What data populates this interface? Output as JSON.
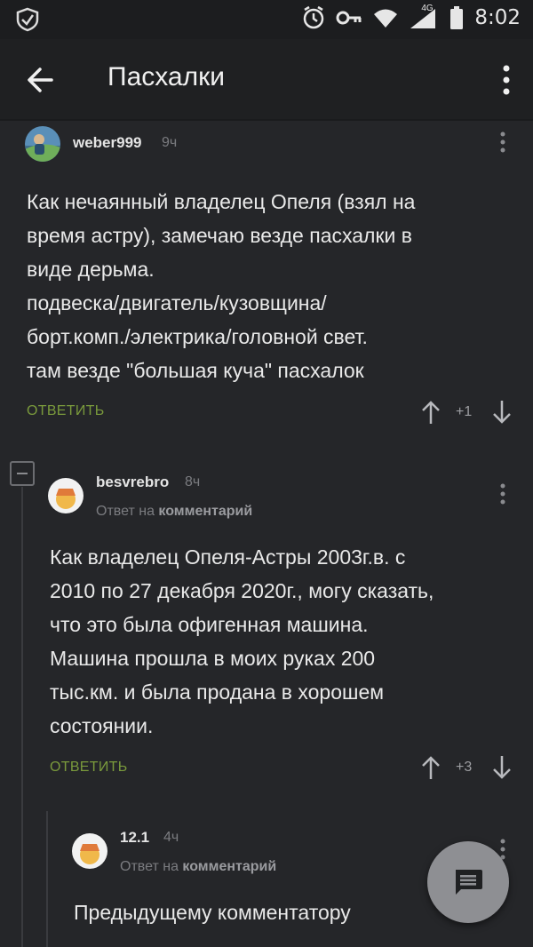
{
  "status_bar": {
    "time": "8:02",
    "network": "4G",
    "icons": [
      "shield-icon",
      "alarm-icon",
      "key-icon",
      "wifi-icon",
      "signal-icon",
      "battery-icon"
    ]
  },
  "app_bar": {
    "title": "Пасхалки",
    "back_icon": "arrow-left-icon",
    "menu_icon": "more-vertical-icon"
  },
  "comments": [
    {
      "username": "weber999",
      "time": "9ч",
      "reply_to": null,
      "text_lines": [
        "Как нечаянный владелец Опеля (взял на",
        "время астру), замечаю везде пасхалки в",
        "виде дерьма.",
        "подвеска/двигатель/кузовщина/",
        "борт.комп./электрика/головной свет.",
        "там везде \"большая куча\" пасхалок"
      ],
      "reply_label": "ОТВЕТИТЬ",
      "score": "+1"
    },
    {
      "username": "besvrebro",
      "time": "8ч",
      "reply_to": {
        "prefix": "Ответ на",
        "target": "комментарий"
      },
      "text_lines": [
        "Как владелец Опеля-Астры 2003г.в. с",
        "2010 по 27 декабря 2020г., могу сказать,",
        "что это была офигенная машина.",
        "Машина прошла в моих руках 200",
        "тыс.км. и была продана в хорошем",
        "состоянии."
      ],
      "reply_label": "ОТВЕТИТЬ",
      "score": "+3"
    },
    {
      "username": "12.1",
      "time": "4ч",
      "reply_to": {
        "prefix": "Ответ на",
        "target": "комментарий"
      },
      "text_lines": [
        "Предыдущему комментатору"
      ]
    }
  ],
  "fab": {
    "icon": "comment-icon"
  },
  "colors": {
    "background": "#252629",
    "app_bar": "#1f2022",
    "accent_reply": "#7a9a3c",
    "fab": "#8e8f93"
  }
}
